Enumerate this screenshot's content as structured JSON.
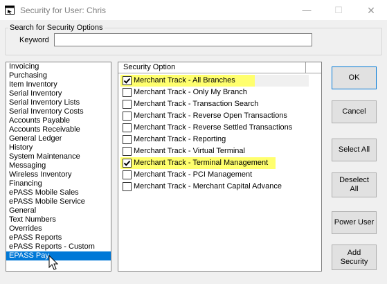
{
  "window": {
    "title": "Security for User: Chris",
    "minimize": "—",
    "maximize": "☐",
    "close": "✕"
  },
  "search": {
    "group_label": "Search for Security Options",
    "keyword_label": "Keyword",
    "keyword_value": "",
    "keyword_placeholder": ""
  },
  "categories": {
    "items": [
      "Invoicing",
      "Purchasing",
      "Item Inventory",
      "Serial Inventory",
      "Serial Inventory Lists",
      "Serial Inventory Costs",
      "Accounts Payable",
      "Accounts Receivable",
      "General Ledger",
      "History",
      "System Maintenance",
      "Messaging",
      "Wireless Inventory",
      "Financing",
      "ePASS Mobile Sales",
      "ePASS Mobile Service",
      "General",
      "Text Numbers",
      "Overrides",
      "ePASS Reports",
      "ePASS Reports - Custom",
      "EPASS Pay"
    ],
    "selected": "EPASS Pay"
  },
  "options": {
    "header": "Security Option",
    "rows": [
      {
        "label": "Merchant Track - All Branches",
        "checked": true,
        "highlighted": true
      },
      {
        "label": "Merchant Track - Only My Branch",
        "checked": false,
        "highlighted": false
      },
      {
        "label": "Merchant Track - Transaction Search",
        "checked": false,
        "highlighted": false
      },
      {
        "label": "Merchant Track - Reverse Open Transactions",
        "checked": false,
        "highlighted": false
      },
      {
        "label": "Merchant Track - Reverse Settled Transactions",
        "checked": false,
        "highlighted": false
      },
      {
        "label": "Merchant Track - Reporting",
        "checked": false,
        "highlighted": false
      },
      {
        "label": "Merchant Track - Virtual Terminal",
        "checked": false,
        "highlighted": false
      },
      {
        "label": "Merchant Track - Terminal Management",
        "checked": true,
        "highlighted": true
      },
      {
        "label": "Merchant Track - PCI Management",
        "checked": false,
        "highlighted": false
      },
      {
        "label": "Merchant Track - Merchant Capital Advance",
        "checked": false,
        "highlighted": false
      }
    ]
  },
  "buttons": {
    "ok": "OK",
    "cancel": "Cancel",
    "select_all": "Select All",
    "deselect_all_line1": "Deselect",
    "deselect_all_line2": "All",
    "power_user": "Power User",
    "add_security_line1": "Add",
    "add_security_line2": "Security"
  },
  "colors": {
    "highlight": "#ffff6e",
    "selection": "#0078d7"
  }
}
